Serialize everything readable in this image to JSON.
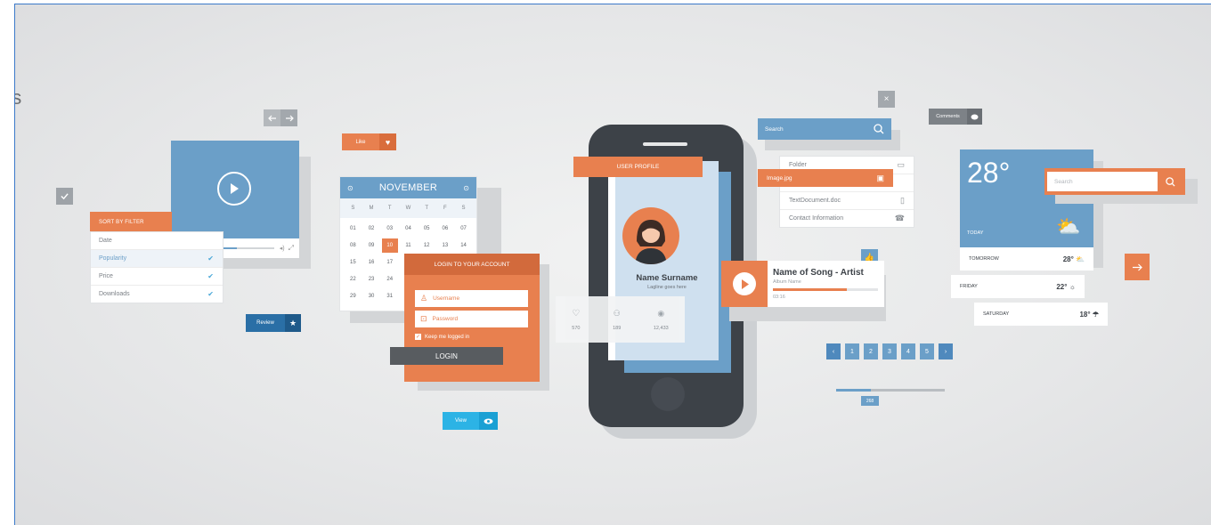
{
  "edge_glyph": "es",
  "like": {
    "label": "Like"
  },
  "review": {
    "label": "Review"
  },
  "view": {
    "label": "View"
  },
  "sort_filter": {
    "header": "SORT BY FILTER",
    "items": [
      "Date",
      "Popularity",
      "Price",
      "Downloads"
    ]
  },
  "calendar": {
    "month": "NOVEMBER",
    "days": [
      "S",
      "M",
      "T",
      "W",
      "T",
      "F",
      "S"
    ],
    "weeks": [
      [
        "01",
        "02",
        "03",
        "04",
        "05",
        "06",
        "07"
      ],
      [
        "08",
        "09",
        "10",
        "11",
        "12",
        "13",
        "14"
      ],
      [
        "15",
        "16",
        "17",
        "",
        "",
        "",
        ""
      ],
      [
        "22",
        "23",
        "24",
        "",
        "",
        "",
        ""
      ],
      [
        "29",
        "30",
        "31",
        "",
        "",
        "",
        ""
      ]
    ],
    "selected": "10"
  },
  "login": {
    "title": "LOGIN TO YOUR ACCOUNT",
    "username_placeholder": "Username",
    "password_placeholder": "Password",
    "remember": "Keep me logged in",
    "button": "LOGIN"
  },
  "profile": {
    "header": "USER PROFILE",
    "name": "Name Surname",
    "tagline": "Lagline goes here",
    "stats": [
      "570",
      "189",
      "12,433"
    ]
  },
  "search_top": {
    "placeholder": "Search"
  },
  "files": {
    "items": [
      "Folder",
      "Image.jpg",
      "TextDocument.doc",
      "Contact Information"
    ]
  },
  "comments": {
    "label": "Comments"
  },
  "song": {
    "title": "Name of Song - Artist",
    "album": "Album Name",
    "time": "03:16",
    "progress": 0.7
  },
  "weather": {
    "temp": "28°",
    "today": "TODAY",
    "search_placeholder": "Search",
    "forecast": [
      {
        "day": "TOMORROW",
        "temp": "28°"
      },
      {
        "day": "FRIDAY",
        "temp": "22°"
      },
      {
        "day": "SATURDAY",
        "temp": "18°"
      }
    ]
  },
  "pagination": {
    "pages": [
      "1",
      "2",
      "3",
      "4",
      "5"
    ]
  },
  "slider": {
    "value_label": "268",
    "value": 0.32
  }
}
